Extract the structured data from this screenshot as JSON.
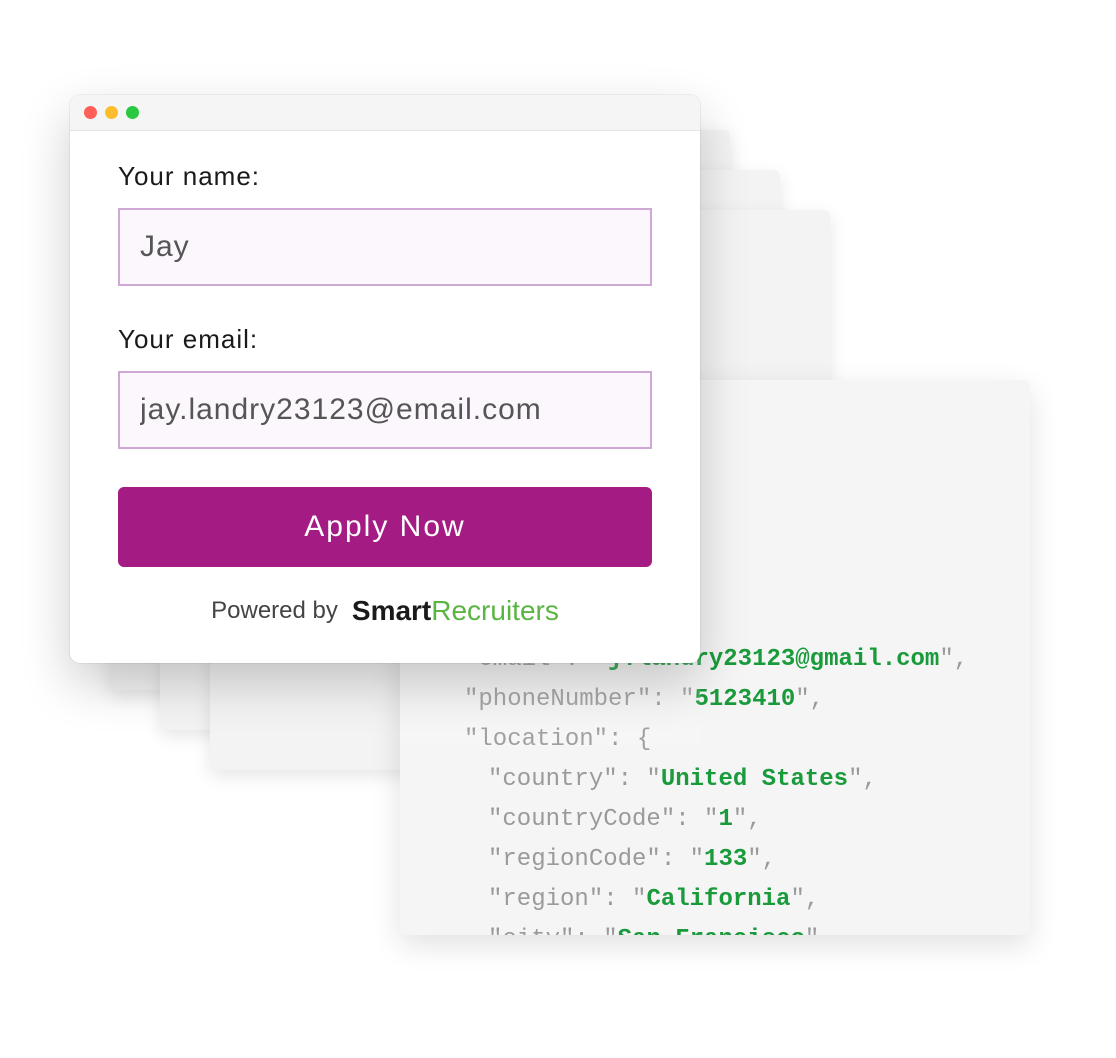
{
  "form": {
    "name_label": "Your name:",
    "name_value": "Jay",
    "email_label": "Your email:",
    "email_value": "jay.landry23123@email.com",
    "apply_label": "Apply Now",
    "powered_by_label": "Powered by",
    "brand_bold": "Smart",
    "brand_rest": "Recruiters"
  },
  "code": {
    "email_key": "\"email\"",
    "email_val": "j.landry23123@gmail.com",
    "phone_key": "\"phoneNumber\"",
    "phone_val": "5123410",
    "location_key": "\"location\"",
    "country_key": "\"country\"",
    "country_val": "United States",
    "countryCode_key": "\"countryCode\"",
    "countryCode_val": "1",
    "regionCode_key": "\"regionCode\"",
    "regionCode_val": "133",
    "region_key": "\"region\"",
    "region_val": "California",
    "city_key": "\"city\"",
    "city_val": "San Francisco"
  }
}
